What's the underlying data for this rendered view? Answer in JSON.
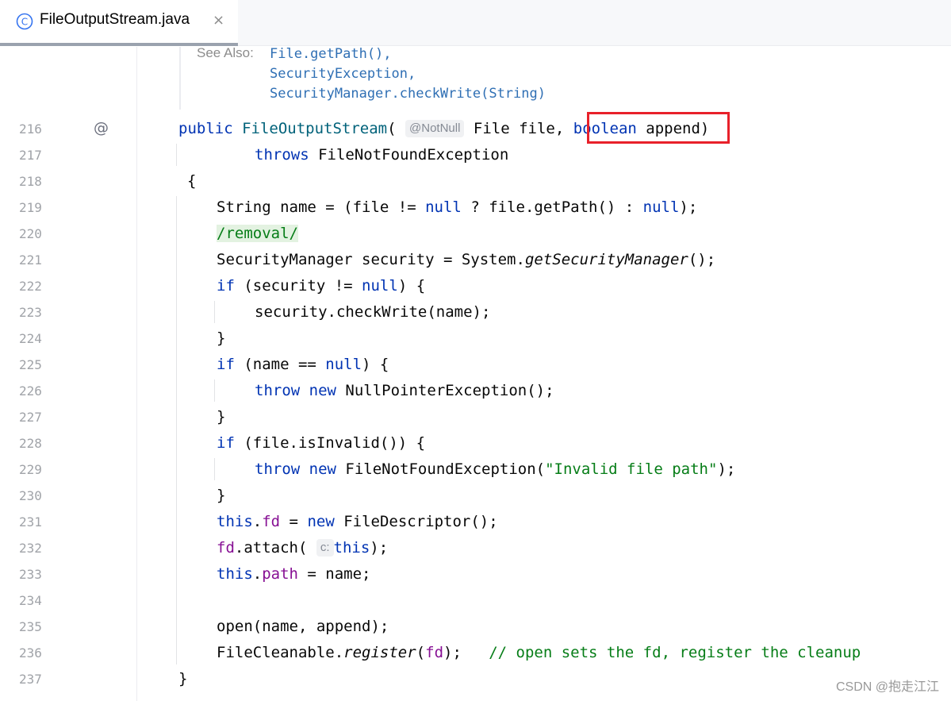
{
  "tab": {
    "title": "FileOutputStream.java",
    "close": "×",
    "icon": "java-class-icon",
    "icon_letter": "C"
  },
  "doc": {
    "see_also_label": "See Also:",
    "links": [
      "File.getPath()",
      "SecurityException",
      "SecurityManager.checkWrite(String)"
    ],
    "comma": ","
  },
  "gutter": {
    "override_icon": "@"
  },
  "lines": [
    {
      "num": "216"
    },
    {
      "num": "217"
    },
    {
      "num": "218"
    },
    {
      "num": "219"
    },
    {
      "num": "220"
    },
    {
      "num": "221"
    },
    {
      "num": "222"
    },
    {
      "num": "223"
    },
    {
      "num": "224"
    },
    {
      "num": "225"
    },
    {
      "num": "226"
    },
    {
      "num": "227"
    },
    {
      "num": "228"
    },
    {
      "num": "229"
    },
    {
      "num": "230"
    },
    {
      "num": "231"
    },
    {
      "num": "232"
    },
    {
      "num": "233"
    },
    {
      "num": "234"
    },
    {
      "num": "235"
    },
    {
      "num": "236"
    },
    {
      "num": "237"
    }
  ],
  "code": {
    "l216": {
      "kw": "public",
      "fn": "FileOutputStream",
      "paren": "(",
      "hint": "@NotNull",
      "rest": "File file, ",
      "kw2": "boolean",
      "arg": " append",
      "close": ")"
    },
    "l217": {
      "kw": "throws",
      "rest": " FileNotFoundException"
    },
    "l218": {
      "text": "{"
    },
    "l219": {
      "a": "String name = (file != ",
      "kw": "null",
      "b": " ? file.getPath() : ",
      "kw2": "null",
      "c": ");"
    },
    "l220": {
      "text": "/removal/"
    },
    "l221": {
      "a": "SecurityManager security = System.",
      "it": "getSecurityManager",
      "c": "();"
    },
    "l222": {
      "kw": "if",
      "a": " (security != ",
      "kw2": "null",
      "c": ") {"
    },
    "l223": {
      "text": "security.checkWrite(name);"
    },
    "l224": {
      "text": "}"
    },
    "l225": {
      "kw": "if",
      "a": " (name == ",
      "kw2": "null",
      "c": ") {"
    },
    "l226": {
      "kw": "throw",
      "sp": " ",
      "kw2": "new",
      "c": " NullPointerException();"
    },
    "l227": {
      "text": "}"
    },
    "l228": {
      "kw": "if",
      "c": " (file.isInvalid()) {"
    },
    "l229": {
      "kw": "throw",
      "sp": " ",
      "kw2": "new",
      "a": " FileNotFoundException(",
      "str": "\"Invalid file path\"",
      "c": ");"
    },
    "l230": {
      "text": "}"
    },
    "l231": {
      "kw": "this",
      "dot": ".",
      "field": "fd",
      "a": " = ",
      "kw2": "new",
      "c": " FileDescriptor();"
    },
    "l232": {
      "field": "fd",
      "a": ".attach(",
      "hint": "c:",
      "sp": " ",
      "kw": "this",
      "c": ");"
    },
    "l233": {
      "kw": "this",
      "dot": ".",
      "field": "path",
      "c": " = name;"
    },
    "l235": {
      "text": "open(name, append);"
    },
    "l236": {
      "a": "FileCleanable.",
      "it": "register",
      "p": "(",
      "field": "fd",
      "c": ");",
      "cmt": "   // open sets the fd, register the cleanup"
    },
    "l237": {
      "text": "}"
    }
  },
  "watermark": "CSDN @抱走江江",
  "colors": {
    "keyword": "#0033b3",
    "string": "#067d17",
    "field": "#871094",
    "highlight_box": "#e8212a"
  }
}
